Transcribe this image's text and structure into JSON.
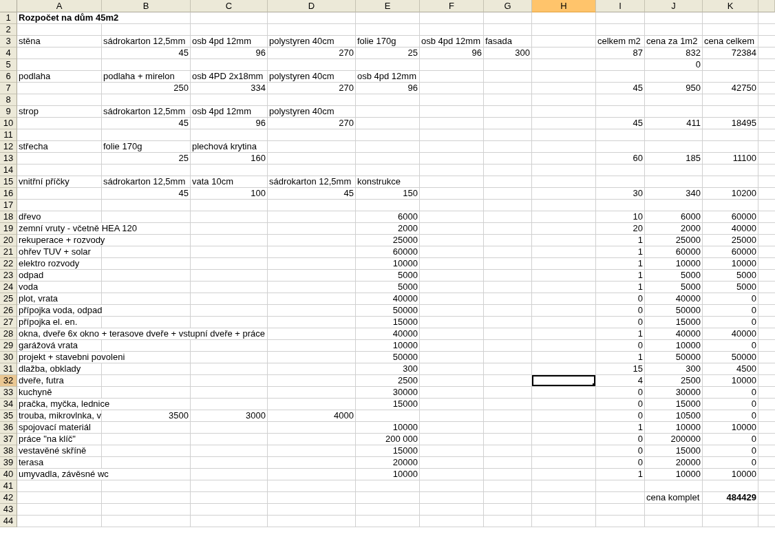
{
  "columns": [
    {
      "label": "A",
      "selected": false
    },
    {
      "label": "B",
      "selected": false
    },
    {
      "label": "C",
      "selected": false
    },
    {
      "label": "D",
      "selected": false
    },
    {
      "label": "E",
      "selected": false
    },
    {
      "label": "F",
      "selected": false
    },
    {
      "label": "G",
      "selected": false
    },
    {
      "label": "H",
      "selected": true
    },
    {
      "label": "I",
      "selected": false
    },
    {
      "label": "J",
      "selected": false
    },
    {
      "label": "K",
      "selected": false
    }
  ],
  "rows": [
    {
      "label": "1",
      "selected": false,
      "cells": [
        {
          "kind": "text",
          "text": "Rozpočet na dům 45m2",
          "bold": true,
          "selected": false
        }
      ]
    },
    {
      "label": "2",
      "selected": false
    },
    {
      "label": "3",
      "selected": false,
      "cells": [
        {
          "kind": "text",
          "text": "stěna",
          "selected": false
        },
        {
          "kind": "text",
          "text": "sádrokarton 12,5mm",
          "selected": false
        },
        {
          "kind": "text",
          "text": "osb 4pd 12mm",
          "selected": false
        },
        {
          "kind": "text",
          "text": "polystyren 40cm",
          "selected": false
        },
        {
          "kind": "text",
          "text": "folie 170g",
          "selected": false
        },
        {
          "kind": "text",
          "text": "osb 4pd 12mm",
          "selected": false
        },
        {
          "kind": "text",
          "text": "fasada",
          "selected": false
        },
        null,
        {
          "kind": "text",
          "text": "celkem m2",
          "selected": false
        },
        {
          "kind": "text",
          "text": "cena za 1m2",
          "selected": false
        },
        {
          "kind": "text",
          "text": "cena celkem",
          "selected": false
        }
      ]
    },
    {
      "label": "4",
      "selected": false,
      "cells": [
        null,
        {
          "kind": "number",
          "text": "45",
          "selected": false
        },
        {
          "kind": "number",
          "text": "96",
          "selected": false
        },
        {
          "kind": "number",
          "text": "270",
          "selected": false
        },
        {
          "kind": "number",
          "text": "25",
          "selected": false
        },
        {
          "kind": "number",
          "text": "96",
          "selected": false
        },
        {
          "kind": "number",
          "text": "300",
          "selected": false
        },
        null,
        {
          "kind": "number",
          "text": "87",
          "selected": false
        },
        {
          "kind": "number",
          "text": "832",
          "selected": false
        },
        {
          "kind": "number",
          "text": "72384",
          "selected": false
        }
      ]
    },
    {
      "label": "5",
      "selected": false,
      "cells": [
        null,
        null,
        null,
        null,
        null,
        null,
        null,
        null,
        null,
        {
          "kind": "number",
          "text": "0",
          "selected": false
        }
      ]
    },
    {
      "label": "6",
      "selected": false,
      "cells": [
        {
          "kind": "text",
          "text": "podlaha",
          "selected": false
        },
        {
          "kind": "text",
          "text": "podlaha + mirelon",
          "selected": false
        },
        {
          "kind": "text",
          "text": "osb 4PD 2x18mm",
          "selected": false
        },
        {
          "kind": "text",
          "text": "polystyren 40cm",
          "selected": false
        },
        {
          "kind": "text",
          "text": "osb 4pd 12mm",
          "selected": false
        }
      ]
    },
    {
      "label": "7",
      "selected": false,
      "cells": [
        null,
        {
          "kind": "number",
          "text": "250",
          "selected": false
        },
        {
          "kind": "number",
          "text": "334",
          "selected": false
        },
        {
          "kind": "number",
          "text": "270",
          "selected": false
        },
        {
          "kind": "number",
          "text": "96",
          "selected": false
        },
        null,
        null,
        null,
        {
          "kind": "number",
          "text": "45",
          "selected": false
        },
        {
          "kind": "number",
          "text": "950",
          "selected": false
        },
        {
          "kind": "number",
          "text": "42750",
          "selected": false
        }
      ]
    },
    {
      "label": "8",
      "selected": false
    },
    {
      "label": "9",
      "selected": false,
      "cells": [
        {
          "kind": "text",
          "text": "strop",
          "selected": false
        },
        {
          "kind": "text",
          "text": "sádrokarton 12,5mm",
          "selected": false
        },
        {
          "kind": "text",
          "text": "osb 4pd 12mm",
          "selected": false
        },
        {
          "kind": "text",
          "text": "polystyren 40cm",
          "selected": false
        }
      ]
    },
    {
      "label": "10",
      "selected": false,
      "cells": [
        null,
        {
          "kind": "number",
          "text": "45",
          "selected": false
        },
        {
          "kind": "number",
          "text": "96",
          "selected": false
        },
        {
          "kind": "number",
          "text": "270",
          "selected": false
        },
        null,
        null,
        null,
        null,
        {
          "kind": "number",
          "text": "45",
          "selected": false
        },
        {
          "kind": "number",
          "text": "411",
          "selected": false
        },
        {
          "kind": "number",
          "text": "18495",
          "selected": false
        }
      ]
    },
    {
      "label": "11",
      "selected": false
    },
    {
      "label": "12",
      "selected": false,
      "cells": [
        {
          "kind": "text",
          "text": "střecha",
          "selected": false
        },
        {
          "kind": "text",
          "text": "folie 170g",
          "selected": false
        },
        {
          "kind": "text",
          "text": "plechová krytina",
          "selected": false
        }
      ]
    },
    {
      "label": "13",
      "selected": false,
      "cells": [
        null,
        {
          "kind": "number",
          "text": "25",
          "selected": false
        },
        {
          "kind": "number",
          "text": "160",
          "selected": false
        },
        null,
        null,
        null,
        null,
        null,
        {
          "kind": "number",
          "text": "60",
          "selected": false
        },
        {
          "kind": "number",
          "text": "185",
          "selected": false
        },
        {
          "kind": "number",
          "text": "11100",
          "selected": false
        }
      ]
    },
    {
      "label": "14",
      "selected": false
    },
    {
      "label": "15",
      "selected": false,
      "cells": [
        {
          "kind": "text",
          "text": "vnitřní příčky",
          "selected": false
        },
        {
          "kind": "text",
          "text": "sádrokarton 12,5mm",
          "selected": false
        },
        {
          "kind": "text",
          "text": "vata 10cm",
          "selected": false
        },
        {
          "kind": "text",
          "text": "sádrokarton 12,5mm",
          "selected": false
        },
        {
          "kind": "text",
          "text": "konstrukce",
          "selected": false
        }
      ]
    },
    {
      "label": "16",
      "selected": false,
      "cells": [
        null,
        {
          "kind": "number",
          "text": "45",
          "selected": false
        },
        {
          "kind": "number",
          "text": "100",
          "selected": false
        },
        {
          "kind": "number",
          "text": "45",
          "selected": false
        },
        {
          "kind": "number",
          "text": "150",
          "selected": false
        },
        null,
        null,
        null,
        {
          "kind": "number",
          "text": "30",
          "selected": false
        },
        {
          "kind": "number",
          "text": "340",
          "selected": false
        },
        {
          "kind": "number",
          "text": "10200",
          "selected": false
        }
      ]
    },
    {
      "label": "17",
      "selected": false
    },
    {
      "label": "18",
      "selected": false,
      "cells": [
        {
          "kind": "text",
          "text": "dřevo",
          "selected": false
        },
        null,
        null,
        null,
        {
          "kind": "number",
          "text": "6000",
          "selected": false
        },
        null,
        null,
        null,
        {
          "kind": "number",
          "text": "10",
          "selected": false
        },
        {
          "kind": "number",
          "text": "6000",
          "selected": false
        },
        {
          "kind": "number",
          "text": "60000",
          "selected": false
        }
      ]
    },
    {
      "label": "19",
      "selected": false,
      "cells": [
        {
          "kind": "text",
          "text": "zemní vruty - včetně HEA 120",
          "selected": false
        },
        null,
        null,
        null,
        {
          "kind": "number",
          "text": "2000",
          "selected": false
        },
        null,
        null,
        null,
        {
          "kind": "number",
          "text": "20",
          "selected": false
        },
        {
          "kind": "number",
          "text": "2000",
          "selected": false
        },
        {
          "kind": "number",
          "text": "40000",
          "selected": false
        }
      ]
    },
    {
      "label": "20",
      "selected": false,
      "cells": [
        {
          "kind": "text",
          "text": "rekuperace + rozvody",
          "selected": false
        },
        null,
        null,
        null,
        {
          "kind": "number",
          "text": "25000",
          "selected": false
        },
        null,
        null,
        null,
        {
          "kind": "number",
          "text": "1",
          "selected": false
        },
        {
          "kind": "number",
          "text": "25000",
          "selected": false
        },
        {
          "kind": "number",
          "text": "25000",
          "selected": false
        }
      ]
    },
    {
      "label": "21",
      "selected": false,
      "cells": [
        {
          "kind": "text",
          "text": "ohřev TUV + solar",
          "selected": false
        },
        null,
        null,
        null,
        {
          "kind": "number",
          "text": "60000",
          "selected": false
        },
        null,
        null,
        null,
        {
          "kind": "number",
          "text": "1",
          "selected": false
        },
        {
          "kind": "number",
          "text": "60000",
          "selected": false
        },
        {
          "kind": "number",
          "text": "60000",
          "selected": false
        }
      ]
    },
    {
      "label": "22",
      "selected": false,
      "cells": [
        {
          "kind": "text",
          "text": "elektro rozvody",
          "selected": false
        },
        null,
        null,
        null,
        {
          "kind": "number",
          "text": "10000",
          "selected": false
        },
        null,
        null,
        null,
        {
          "kind": "number",
          "text": "1",
          "selected": false
        },
        {
          "kind": "number",
          "text": "10000",
          "selected": false
        },
        {
          "kind": "number",
          "text": "10000",
          "selected": false
        }
      ]
    },
    {
      "label": "23",
      "selected": false,
      "cells": [
        {
          "kind": "text",
          "text": "odpad",
          "selected": false
        },
        null,
        null,
        null,
        {
          "kind": "number",
          "text": "5000",
          "selected": false
        },
        null,
        null,
        null,
        {
          "kind": "number",
          "text": "1",
          "selected": false
        },
        {
          "kind": "number",
          "text": "5000",
          "selected": false
        },
        {
          "kind": "number",
          "text": "5000",
          "selected": false
        }
      ]
    },
    {
      "label": "24",
      "selected": false,
      "cells": [
        {
          "kind": "text",
          "text": "voda",
          "selected": false
        },
        null,
        null,
        null,
        {
          "kind": "number",
          "text": "5000",
          "selected": false
        },
        null,
        null,
        null,
        {
          "kind": "number",
          "text": "1",
          "selected": false
        },
        {
          "kind": "number",
          "text": "5000",
          "selected": false
        },
        {
          "kind": "number",
          "text": "5000",
          "selected": false
        }
      ]
    },
    {
      "label": "25",
      "selected": false,
      "cells": [
        {
          "kind": "text",
          "text": "plot, vrata",
          "selected": false
        },
        null,
        null,
        null,
        {
          "kind": "number",
          "text": "40000",
          "selected": false
        },
        null,
        null,
        null,
        {
          "kind": "number",
          "text": "0",
          "selected": false
        },
        {
          "kind": "number",
          "text": "40000",
          "selected": false
        },
        {
          "kind": "number",
          "text": "0",
          "selected": false
        }
      ]
    },
    {
      "label": "26",
      "selected": false,
      "cells": [
        {
          "kind": "text",
          "text": "přípojka voda, odpad",
          "selected": false
        },
        null,
        null,
        null,
        {
          "kind": "number",
          "text": "50000",
          "selected": false
        },
        null,
        null,
        null,
        {
          "kind": "number",
          "text": "0",
          "selected": false
        },
        {
          "kind": "number",
          "text": "50000",
          "selected": false
        },
        {
          "kind": "number",
          "text": "0",
          "selected": false
        }
      ]
    },
    {
      "label": "27",
      "selected": false,
      "cells": [
        {
          "kind": "text",
          "text": "přípojka el. en.",
          "selected": false
        },
        null,
        null,
        null,
        {
          "kind": "number",
          "text": "15000",
          "selected": false
        },
        null,
        null,
        null,
        {
          "kind": "number",
          "text": "0",
          "selected": false
        },
        {
          "kind": "number",
          "text": "15000",
          "selected": false
        },
        {
          "kind": "number",
          "text": "0",
          "selected": false
        }
      ]
    },
    {
      "label": "28",
      "selected": false,
      "cells": [
        {
          "kind": "text",
          "text": "okna, dveře 6x okno + terasove dveře + vstupní dveře + práce",
          "selected": false
        },
        null,
        null,
        null,
        {
          "kind": "number",
          "text": "40000",
          "selected": false
        },
        null,
        null,
        null,
        {
          "kind": "number",
          "text": "1",
          "selected": false
        },
        {
          "kind": "number",
          "text": "40000",
          "selected": false
        },
        {
          "kind": "number",
          "text": "40000",
          "selected": false
        }
      ]
    },
    {
      "label": "29",
      "selected": false,
      "cells": [
        {
          "kind": "text",
          "text": "garážová vrata",
          "selected": false
        },
        null,
        null,
        null,
        {
          "kind": "number",
          "text": "10000",
          "selected": false
        },
        null,
        null,
        null,
        {
          "kind": "number",
          "text": "0",
          "selected": false
        },
        {
          "kind": "number",
          "text": "10000",
          "selected": false
        },
        {
          "kind": "number",
          "text": "0",
          "selected": false
        }
      ]
    },
    {
      "label": "30",
      "selected": false,
      "cells": [
        {
          "kind": "text",
          "text": "projekt + stavebni povoleni",
          "selected": false
        },
        null,
        null,
        null,
        {
          "kind": "number",
          "text": "50000",
          "selected": false
        },
        null,
        null,
        null,
        {
          "kind": "number",
          "text": "1",
          "selected": false
        },
        {
          "kind": "number",
          "text": "50000",
          "selected": false
        },
        {
          "kind": "number",
          "text": "50000",
          "selected": false
        }
      ]
    },
    {
      "label": "31",
      "selected": false,
      "cells": [
        {
          "kind": "text",
          "text": "dlažba, obklady",
          "selected": false
        },
        null,
        null,
        null,
        {
          "kind": "number",
          "text": "300",
          "selected": false
        },
        null,
        null,
        null,
        {
          "kind": "number",
          "text": "15",
          "selected": false
        },
        {
          "kind": "number",
          "text": "300",
          "selected": false
        },
        {
          "kind": "number",
          "text": "4500",
          "selected": false
        }
      ]
    },
    {
      "label": "32",
      "selected": true,
      "cells": [
        {
          "kind": "text",
          "text": "dveře, futra",
          "selected": false
        },
        null,
        null,
        null,
        {
          "kind": "number",
          "text": "2500",
          "selected": false
        },
        null,
        null,
        {
          "selected": true
        },
        {
          "kind": "number",
          "text": "4",
          "selected": false
        },
        {
          "kind": "number",
          "text": "2500",
          "selected": false
        },
        {
          "kind": "number",
          "text": "10000",
          "selected": false
        }
      ]
    },
    {
      "label": "33",
      "selected": false,
      "cells": [
        {
          "kind": "text",
          "text": "kuchyně",
          "selected": false
        },
        null,
        null,
        null,
        {
          "kind": "number",
          "text": "30000",
          "selected": false
        },
        null,
        null,
        null,
        {
          "kind": "number",
          "text": "0",
          "selected": false
        },
        {
          "kind": "number",
          "text": "30000",
          "selected": false
        },
        {
          "kind": "number",
          "text": "0",
          "selected": false
        }
      ]
    },
    {
      "label": "34",
      "selected": false,
      "cells": [
        {
          "kind": "text",
          "text": "pračka, myčka, lednice",
          "selected": false
        },
        null,
        null,
        null,
        {
          "kind": "number",
          "text": "15000",
          "selected": false
        },
        null,
        null,
        null,
        {
          "kind": "number",
          "text": "0",
          "selected": false
        },
        {
          "kind": "number",
          "text": "15000",
          "selected": false
        },
        {
          "kind": "number",
          "text": "0",
          "selected": false
        }
      ]
    },
    {
      "label": "35",
      "selected": false,
      "cells": [
        {
          "kind": "text",
          "text": "trouba, mikrovlnka, v",
          "selected": false
        },
        {
          "kind": "number",
          "text": "3500",
          "selected": false
        },
        {
          "kind": "number",
          "text": "3000",
          "selected": false
        },
        {
          "kind": "number",
          "text": "4000",
          "selected": false
        },
        null,
        null,
        null,
        null,
        {
          "kind": "number",
          "text": "0",
          "selected": false
        },
        {
          "kind": "number",
          "text": "10500",
          "selected": false
        },
        {
          "kind": "number",
          "text": "0",
          "selected": false
        }
      ]
    },
    {
      "label": "36",
      "selected": false,
      "cells": [
        {
          "kind": "text",
          "text": "spojovací materiál",
          "selected": false
        },
        null,
        null,
        null,
        {
          "kind": "number",
          "text": "10000",
          "selected": false
        },
        null,
        null,
        null,
        {
          "kind": "number",
          "text": "1",
          "selected": false
        },
        {
          "kind": "number",
          "text": "10000",
          "selected": false
        },
        {
          "kind": "number",
          "text": "10000",
          "selected": false
        }
      ]
    },
    {
      "label": "37",
      "selected": false,
      "cells": [
        {
          "kind": "text",
          "text": "práce \"na klíč\"",
          "selected": false
        },
        null,
        null,
        null,
        {
          "kind": "number",
          "text": "200 000",
          "selected": false
        },
        null,
        null,
        null,
        {
          "kind": "number",
          "text": "0",
          "selected": false
        },
        {
          "kind": "number",
          "text": "200000",
          "selected": false
        },
        {
          "kind": "number",
          "text": "0",
          "selected": false
        }
      ]
    },
    {
      "label": "38",
      "selected": false,
      "cells": [
        {
          "kind": "text",
          "text": "vestavěné skříně",
          "selected": false
        },
        null,
        null,
        null,
        {
          "kind": "number",
          "text": "15000",
          "selected": false
        },
        null,
        null,
        null,
        {
          "kind": "number",
          "text": "0",
          "selected": false
        },
        {
          "kind": "number",
          "text": "15000",
          "selected": false
        },
        {
          "kind": "number",
          "text": "0",
          "selected": false
        }
      ]
    },
    {
      "label": "39",
      "selected": false,
      "cells": [
        {
          "kind": "text",
          "text": "terasa",
          "selected": false
        },
        null,
        null,
        null,
        {
          "kind": "number",
          "text": "20000",
          "selected": false
        },
        null,
        null,
        null,
        {
          "kind": "number",
          "text": "0",
          "selected": false
        },
        {
          "kind": "number",
          "text": "20000",
          "selected": false
        },
        {
          "kind": "number",
          "text": "0",
          "selected": false
        }
      ]
    },
    {
      "label": "40",
      "selected": false,
      "cells": [
        {
          "kind": "text",
          "text": "umyvadla, závěsné wc",
          "selected": false
        },
        null,
        null,
        null,
        {
          "kind": "number",
          "text": "10000",
          "selected": false
        },
        null,
        null,
        null,
        {
          "kind": "number",
          "text": "1",
          "selected": false
        },
        {
          "kind": "number",
          "text": "10000",
          "selected": false
        },
        {
          "kind": "number",
          "text": "10000",
          "selected": false
        }
      ]
    },
    {
      "label": "41",
      "selected": false
    },
    {
      "label": "42",
      "selected": false,
      "cells": [
        null,
        null,
        null,
        null,
        null,
        null,
        null,
        null,
        null,
        {
          "kind": "text",
          "text": "cena komplet",
          "selected": false
        },
        {
          "kind": "number",
          "text": "484429",
          "bold": true,
          "selected": false
        }
      ]
    },
    {
      "label": "43",
      "selected": false
    },
    {
      "label": "44",
      "selected": false
    }
  ]
}
